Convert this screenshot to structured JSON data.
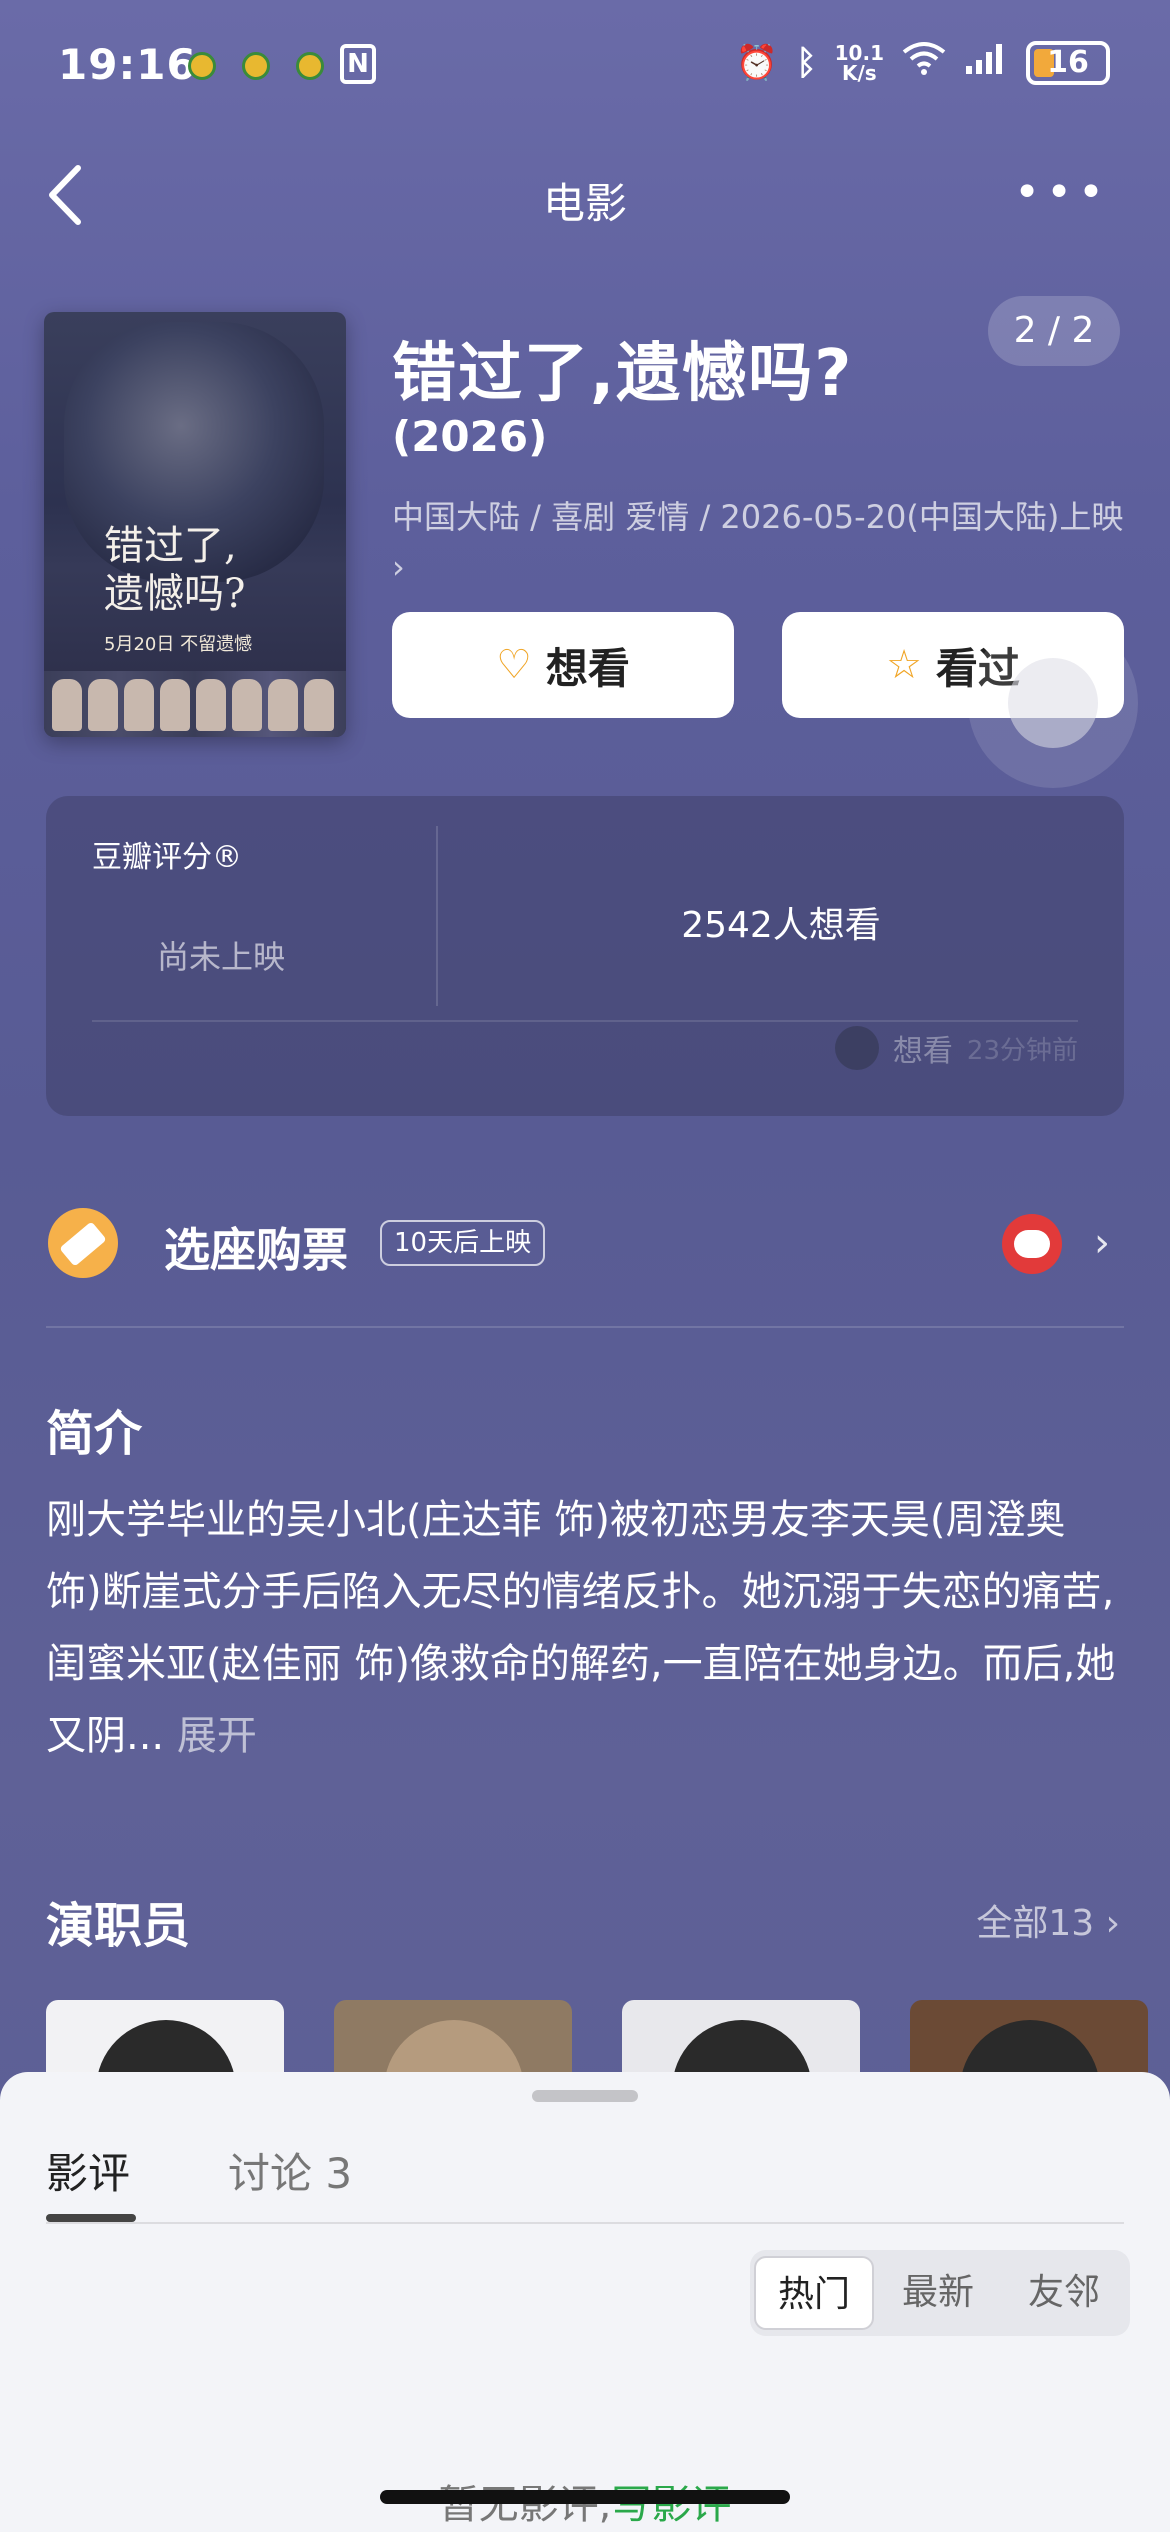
{
  "status_bar": {
    "time": "19:16",
    "nfc": "N",
    "speed_top": "10.1",
    "speed_unit": "K/s",
    "signal_label": "6",
    "battery": "16"
  },
  "nav": {
    "title": "电影",
    "more": "•••"
  },
  "poster": {
    "title_line1": "错过了,",
    "title_line2": "遗憾吗?",
    "release_text": "5月20日 不留遗憾"
  },
  "movie": {
    "title": "错过了,遗憾吗?",
    "year": "(2026)",
    "meta": "中国大陆 / 喜剧 爱情 / 2026-05-20(中国大陆)上映 ›",
    "page_badge": "2 / 2"
  },
  "actions": {
    "want": "想看",
    "seen": "看过"
  },
  "rating": {
    "label": "豆瓣评分®",
    "status": "尚未上映",
    "want_count": "2542人想看",
    "recent_action": "想看",
    "recent_time": "23分钟前"
  },
  "ticket": {
    "label": "选座购票",
    "tag": "10天后上映",
    "chevron": "›"
  },
  "synopsis": {
    "title": "简介",
    "text": "刚大学毕业的吴小北(庄达菲 饰)被初恋男友李天昊(周澄奥 饰)断崖式分手后陷入无尽的情绪反扑。她沉溺于失恋的痛苦,闺蜜米亚(赵佳丽 饰)像救命的解药,一直陪在她身边。而后,她又阴...",
    "expand": "展开"
  },
  "cast": {
    "title": "演职员",
    "all": "全部13 ›"
  },
  "sheet": {
    "tab_review": "影评",
    "tab_discuss": "讨论 3",
    "sort_hot": "热门",
    "sort_new": "最新",
    "sort_friends": "友邻",
    "empty_text": "暂无影评,",
    "write_review": "写影评"
  },
  "colors": {
    "accent": "#f0a526",
    "write": "#2aa84a",
    "bg": "#595d94"
  }
}
